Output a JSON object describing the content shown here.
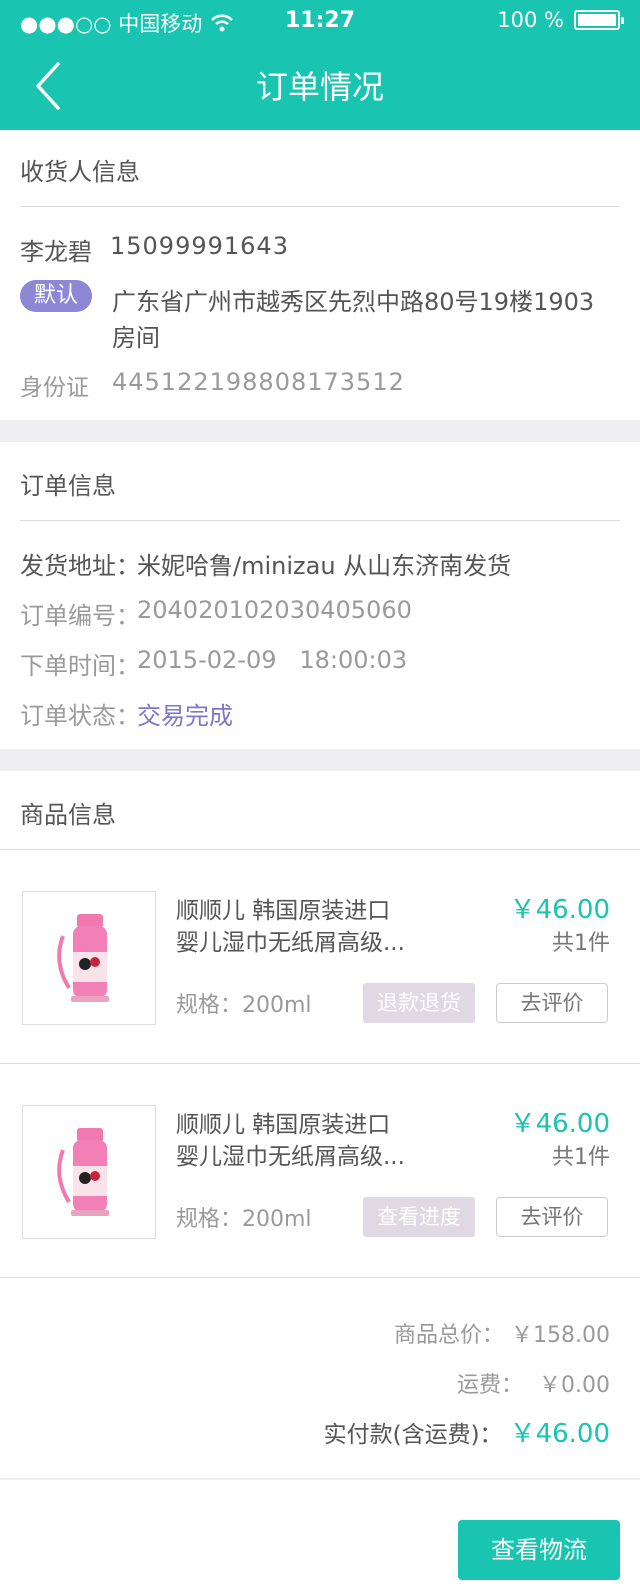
{
  "status_bar": {
    "carrier": "●●●○○ 中国移动",
    "time": "11:27",
    "battery": "100 %"
  },
  "nav": {
    "title": "订单情况"
  },
  "receiver": {
    "section_title": "收货人信息",
    "name": "李龙碧",
    "phone": "15099991643",
    "default_badge": "默认",
    "address_line1": "广东省广州市越秀区先烈中路80号19楼1903",
    "address_line2": "房间",
    "id_label": "身份证",
    "id_number": "445122198808173512"
  },
  "order": {
    "section_title": "订单信息",
    "ship_label": "发货地址：",
    "ship_value": "米妮哈鲁/minizau 从山东济南发货",
    "no_label": "订单编号：",
    "no_value": "204020102030405060",
    "time_label": "下单时间：",
    "time_value": "2015-02-09   18:00:03",
    "status_label": "订单状态：",
    "status_value": "交易完成"
  },
  "goods": {
    "section_title": "商品信息",
    "items": [
      {
        "title_line1": "顺顺儿 韩国原装进口",
        "title_line2": "婴儿湿巾无纸屑高级...",
        "spec": "规格：200ml",
        "price": "￥46.00",
        "qty": "共1件",
        "action": "退款退货",
        "review": "去评价"
      },
      {
        "title_line1": "顺顺儿 韩国原装进口",
        "title_line2": "婴儿湿巾无纸屑高级...",
        "spec": "规格：200ml",
        "price": "￥46.00",
        "qty": "共1件",
        "action": "查看进度",
        "review": "去评价"
      }
    ]
  },
  "summary": {
    "goods_total_label": "商品总价：",
    "goods_total": "￥158.00",
    "shipping_label": "运费：",
    "shipping": "￥0.00",
    "paid_label": "实付款(含运费)：",
    "paid": "￥46.00"
  },
  "footer": {
    "logistics_button": "查看物流"
  },
  "colors": {
    "accent": "#19c4b0",
    "badge": "#8d87d6",
    "status": "#7c77cc"
  }
}
